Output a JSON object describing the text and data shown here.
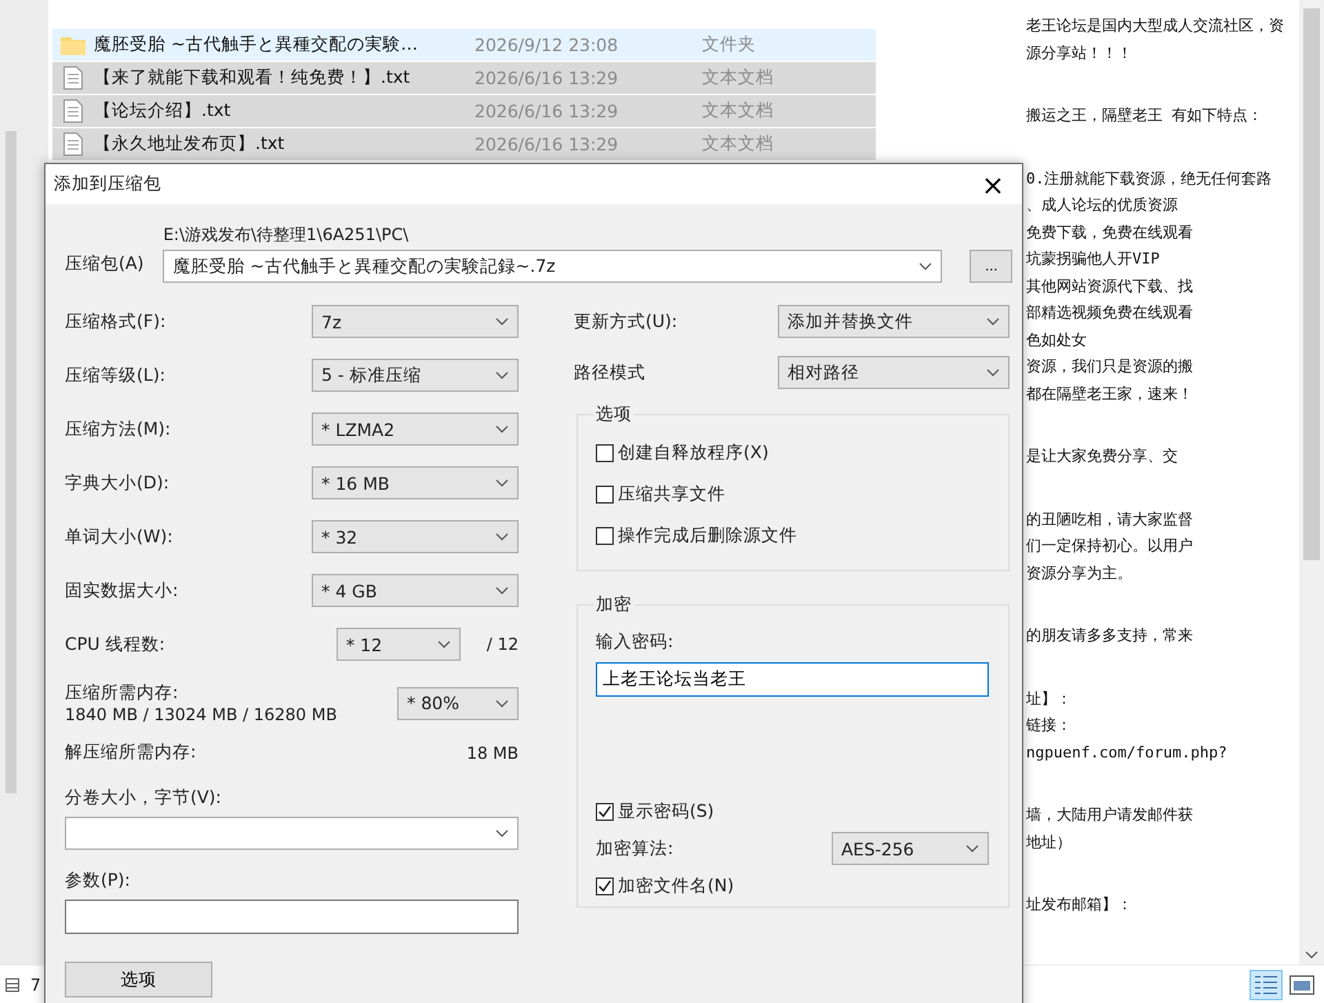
{
  "explorer": {
    "files": [
      {
        "kind": "folder",
        "name": "魔胚受胎 ~古代触手と異種交配の実験…",
        "date": "2026/9/12 23:08",
        "type": "文件夹",
        "selected": false,
        "hovered": true
      },
      {
        "kind": "text",
        "name": "【来了就能下载和观看！纯免费！】.txt",
        "date": "2026/6/16 13:29",
        "type": "文本文档",
        "selected": true,
        "hovered": false
      },
      {
        "kind": "text",
        "name": "【论坛介绍】.txt",
        "date": "2026/6/16 13:29",
        "type": "文本文档",
        "selected": true,
        "hovered": false
      },
      {
        "kind": "text",
        "name": "【永久地址发布页】.txt",
        "date": "2026/6/16 13:29",
        "type": "文本文档",
        "selected": true,
        "hovered": false
      }
    ],
    "status": "7"
  },
  "editor": {
    "paragraphs": [
      [
        "老王论坛是国内大型成人交流社区，资",
        "源分享站！！！"
      ],
      [
        "搬运之王，隔壁老王 有如下特点："
      ],
      [
        "0.注册就能下载资源，绝无任何套路",
        "、成人论坛的优质资源",
        "免费下载，免费在线观看",
        "坑蒙拐骗他人开VIP",
        "其他网站资源代下载、找",
        "部精选视频免费在线观看",
        "色如处女",
        "资源，我们只是资源的搬",
        "都在隔壁老王家，速来！"
      ],
      [
        "是让大家免费分享、交"
      ],
      [
        "的丑陋吃相，请大家监督",
        "们一定保持初心。以用户",
        "资源分享为主。"
      ],
      [
        "的朋友请多多支持，常来"
      ],
      [
        "址】：",
        "链接：",
        "ngpuenf.com/forum.php?"
      ],
      [
        "墙，大陆用户请发邮件获",
        "地址）"
      ],
      [
        "址发布邮箱】："
      ]
    ]
  },
  "dialog": {
    "title": "添加到压缩包",
    "close": "×",
    "archive": {
      "label": "压缩包(A)",
      "path": "E:\\游戏发布\\待整理1\\6A251\\PC\\",
      "value": "魔胚受胎 ~古代触手と異種交配の実験記録~.7z",
      "browse": "..."
    },
    "settings": [
      {
        "label": "压缩格式(F):",
        "value": "7z"
      },
      {
        "label": "压缩等级(L):",
        "value": "5 - 标准压缩"
      },
      {
        "label": "压缩方法(M):",
        "value": "* LZMA2"
      },
      {
        "label": "字典大小(D):",
        "value": "* 16 MB"
      },
      {
        "label": "单词大小(W):",
        "value": "* 32"
      },
      {
        "label": "固实数据大小:",
        "value": "* 4 GB"
      }
    ],
    "cpu": {
      "label": "CPU 线程数:",
      "value": "* 12",
      "max": "/ 12"
    },
    "memory": {
      "label": "压缩所需内存:",
      "usage": "1840 MB / 13024 MB / 16280 MB",
      "value": "* 80%"
    },
    "decompress": {
      "label": "解压缩所需内存:",
      "value": "18 MB"
    },
    "volume": {
      "label": "分卷大小，字节(V):"
    },
    "params": {
      "label": "参数(P):"
    },
    "options_button": "选项",
    "update": {
      "label": "更新方式(U):",
      "value": "添加并替换文件"
    },
    "path_mode": {
      "label": "路径模式",
      "value": "相对路径"
    },
    "options_group": {
      "title": "选项",
      "items": [
        {
          "label": "创建自释放程序(X)",
          "checked": false
        },
        {
          "label": "压缩共享文件",
          "checked": false
        },
        {
          "label": "操作完成后删除源文件",
          "checked": false
        }
      ]
    },
    "encryption": {
      "title": "加密",
      "password_label": "输入密码:",
      "password": "上老王论坛当老王",
      "show_password": {
        "label": "显示密码(S)",
        "checked": true
      },
      "method": {
        "label": "加密算法:",
        "value": "AES-256"
      },
      "encrypt_names": {
        "label": "加密文件名(N)",
        "checked": true
      }
    }
  }
}
